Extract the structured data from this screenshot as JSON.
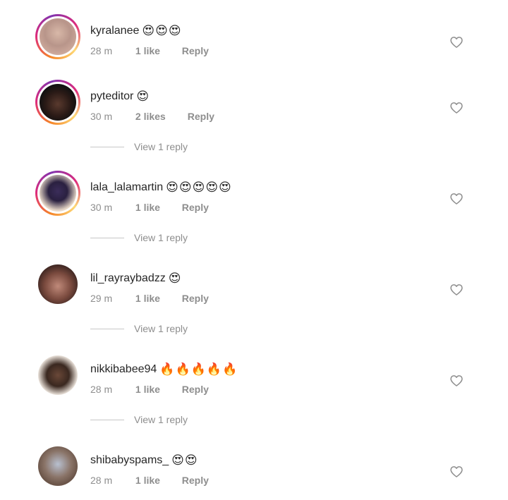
{
  "comments": [
    {
      "username": "kyralanee",
      "emojis": "😍😍😍",
      "time": "28 m",
      "likes": "1 like",
      "reply": "Reply",
      "view_replies": null
    },
    {
      "username": "pyteditor",
      "emojis": "😍",
      "time": "30 m",
      "likes": "2 likes",
      "reply": "Reply",
      "view_replies": "View 1 reply"
    },
    {
      "username": "lala_lalamartin",
      "emojis": "😍😍😍😍😍",
      "time": "30 m",
      "likes": "1 like",
      "reply": "Reply",
      "view_replies": "View 1 reply"
    },
    {
      "username": "lil_rayraybadzz",
      "emojis": "😍",
      "time": "29 m",
      "likes": "1 like",
      "reply": "Reply",
      "view_replies": "View 1 reply"
    },
    {
      "username": "nikkibabee94",
      "emojis": "🔥🔥🔥🔥🔥",
      "time": "28 m",
      "likes": "1 like",
      "reply": "Reply",
      "view_replies": "View 1 reply"
    },
    {
      "username": "shibabyspams_",
      "emojis": "😍😍",
      "time": "28 m",
      "likes": "1 like",
      "reply": "Reply",
      "view_replies": null
    }
  ],
  "icons": {
    "like": "heart-outline-icon"
  },
  "colors": {
    "meta_text": "#8e8e8e",
    "username_text": "#262626",
    "heart_stroke": "#8e8e8e"
  }
}
